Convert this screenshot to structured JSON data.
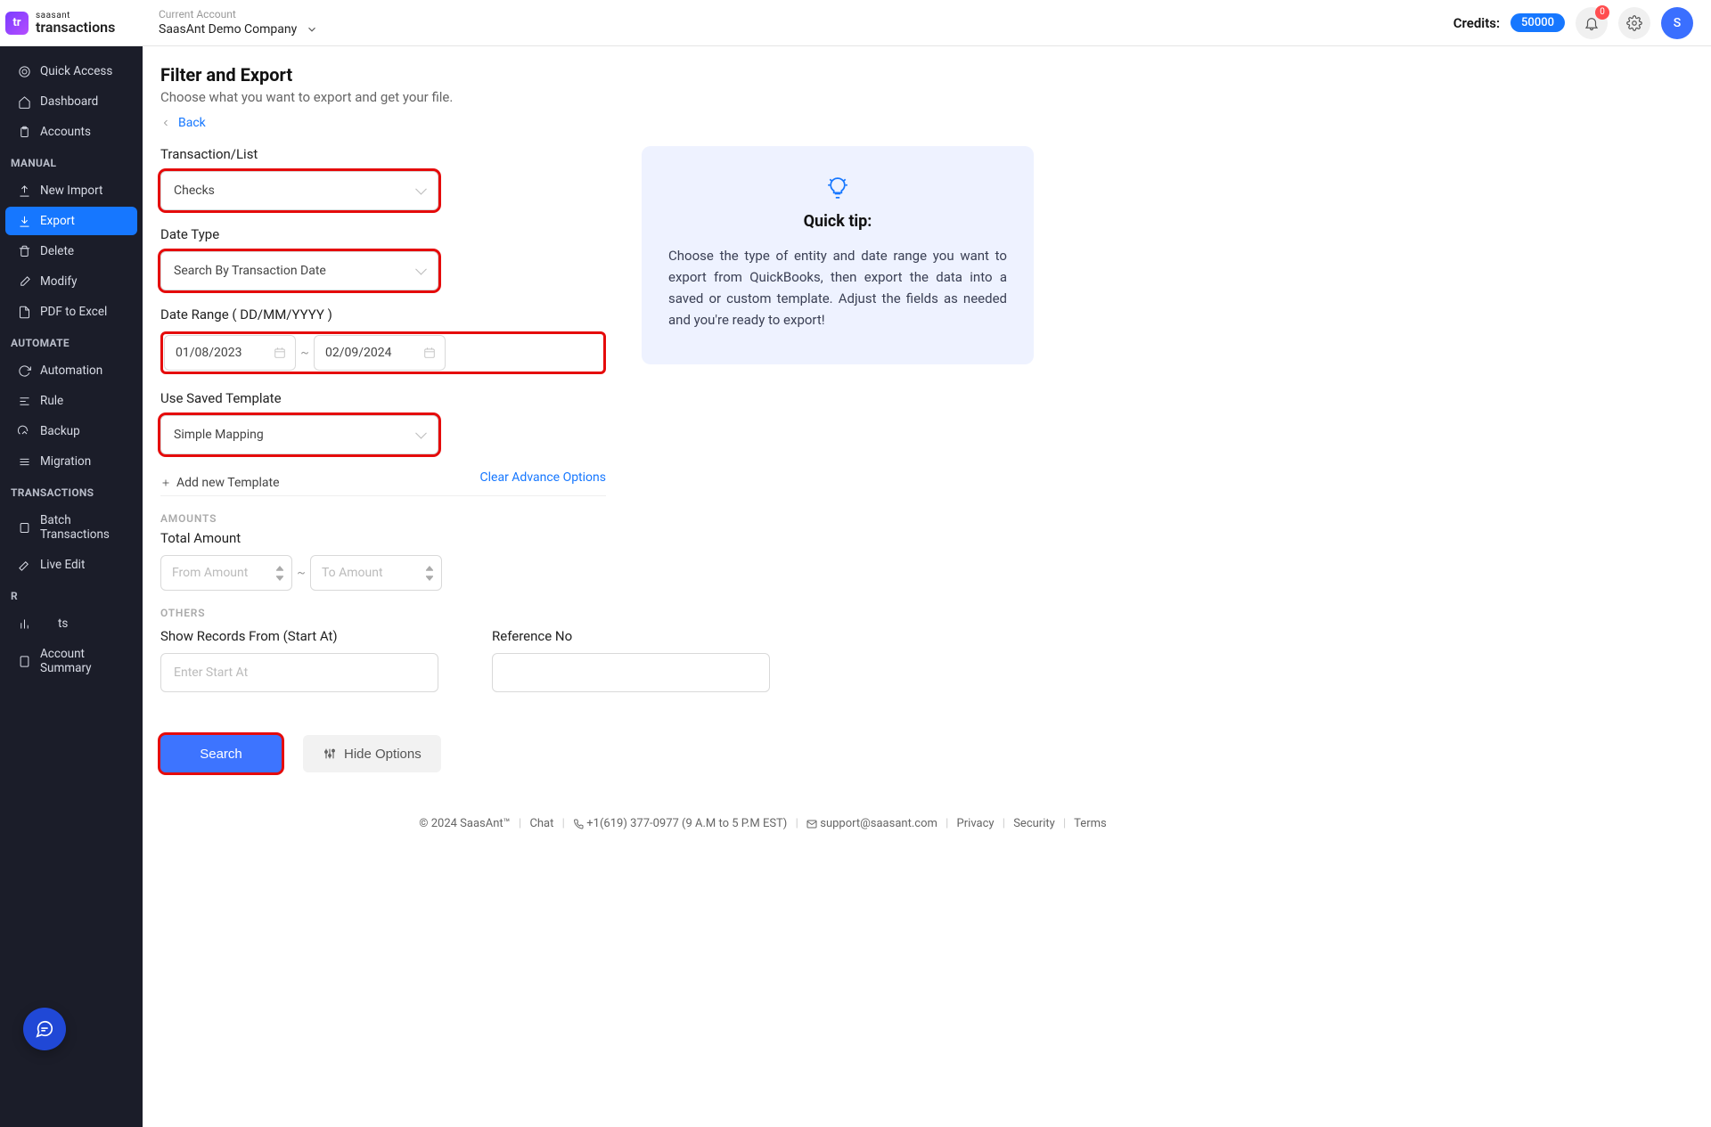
{
  "brand": {
    "line1": "saasant",
    "line2": "transactions",
    "logo_letters": "tr"
  },
  "header": {
    "account_label": "Current Account",
    "account_name": "SaasAnt Demo Company",
    "credits_label": "Credits:",
    "credits_value": "50000",
    "notif_count": "0",
    "avatar_letter": "S"
  },
  "sidebar": {
    "items_top": [
      {
        "label": "Quick Access"
      },
      {
        "label": "Dashboard"
      },
      {
        "label": "Accounts"
      }
    ],
    "manual_title": "MANUAL",
    "items_manual": [
      {
        "label": "New Import"
      },
      {
        "label": "Export",
        "active": true
      },
      {
        "label": "Delete"
      },
      {
        "label": "Modify"
      },
      {
        "label": "PDF to Excel"
      }
    ],
    "automate_title": "AUTOMATE",
    "items_automate": [
      {
        "label": "Automation"
      },
      {
        "label": "Rule"
      },
      {
        "label": "Backup"
      },
      {
        "label": "Migration"
      }
    ],
    "trans_title": "TRANSACTIONS",
    "items_trans": [
      {
        "label": "Batch Transactions"
      },
      {
        "label": "Live Edit"
      }
    ],
    "reports_title_partial": "R",
    "items_reports": [
      {
        "label": "ts"
      },
      {
        "label": "Account Summary"
      }
    ]
  },
  "page": {
    "title": "Filter and Export",
    "subtitle": "Choose what you want to export and get your file.",
    "back": "Back"
  },
  "form": {
    "transaction_label": "Transaction/List",
    "transaction_value": "Checks",
    "date_type_label": "Date Type",
    "date_type_value": "Search By Transaction Date",
    "date_range_label": "Date Range ( DD/MM/YYYY )",
    "date_from": "01/08/2023",
    "date_to": "02/09/2024",
    "template_label": "Use Saved Template",
    "template_value": "Simple Mapping",
    "add_template": "Add new Template",
    "clear_advance": "Clear Advance Options",
    "amounts_section": "AMOUNTS",
    "total_amount_label": "Total Amount",
    "from_amount_ph": "From Amount",
    "to_amount_ph": "To Amount",
    "others_section": "OTHERS",
    "show_records_label": "Show Records From (Start At)",
    "show_records_ph": "Enter Start At",
    "reference_label": "Reference No",
    "search_btn": "Search",
    "hide_options_btn": "Hide Options"
  },
  "tip": {
    "title": "Quick tip:",
    "body": "Choose the type of entity and date range you want to export from QuickBooks, then export the data into a saved or custom template. Adjust the fields as needed and you're ready to export!"
  },
  "footer": {
    "copyright": "© 2024 SaasAnt™",
    "chat": "Chat",
    "phone": "+1(619) 377-0977 (9 A.M to 5 P.M EST)",
    "email": "support@saasant.com",
    "privacy": "Privacy",
    "security": "Security",
    "terms": "Terms"
  }
}
